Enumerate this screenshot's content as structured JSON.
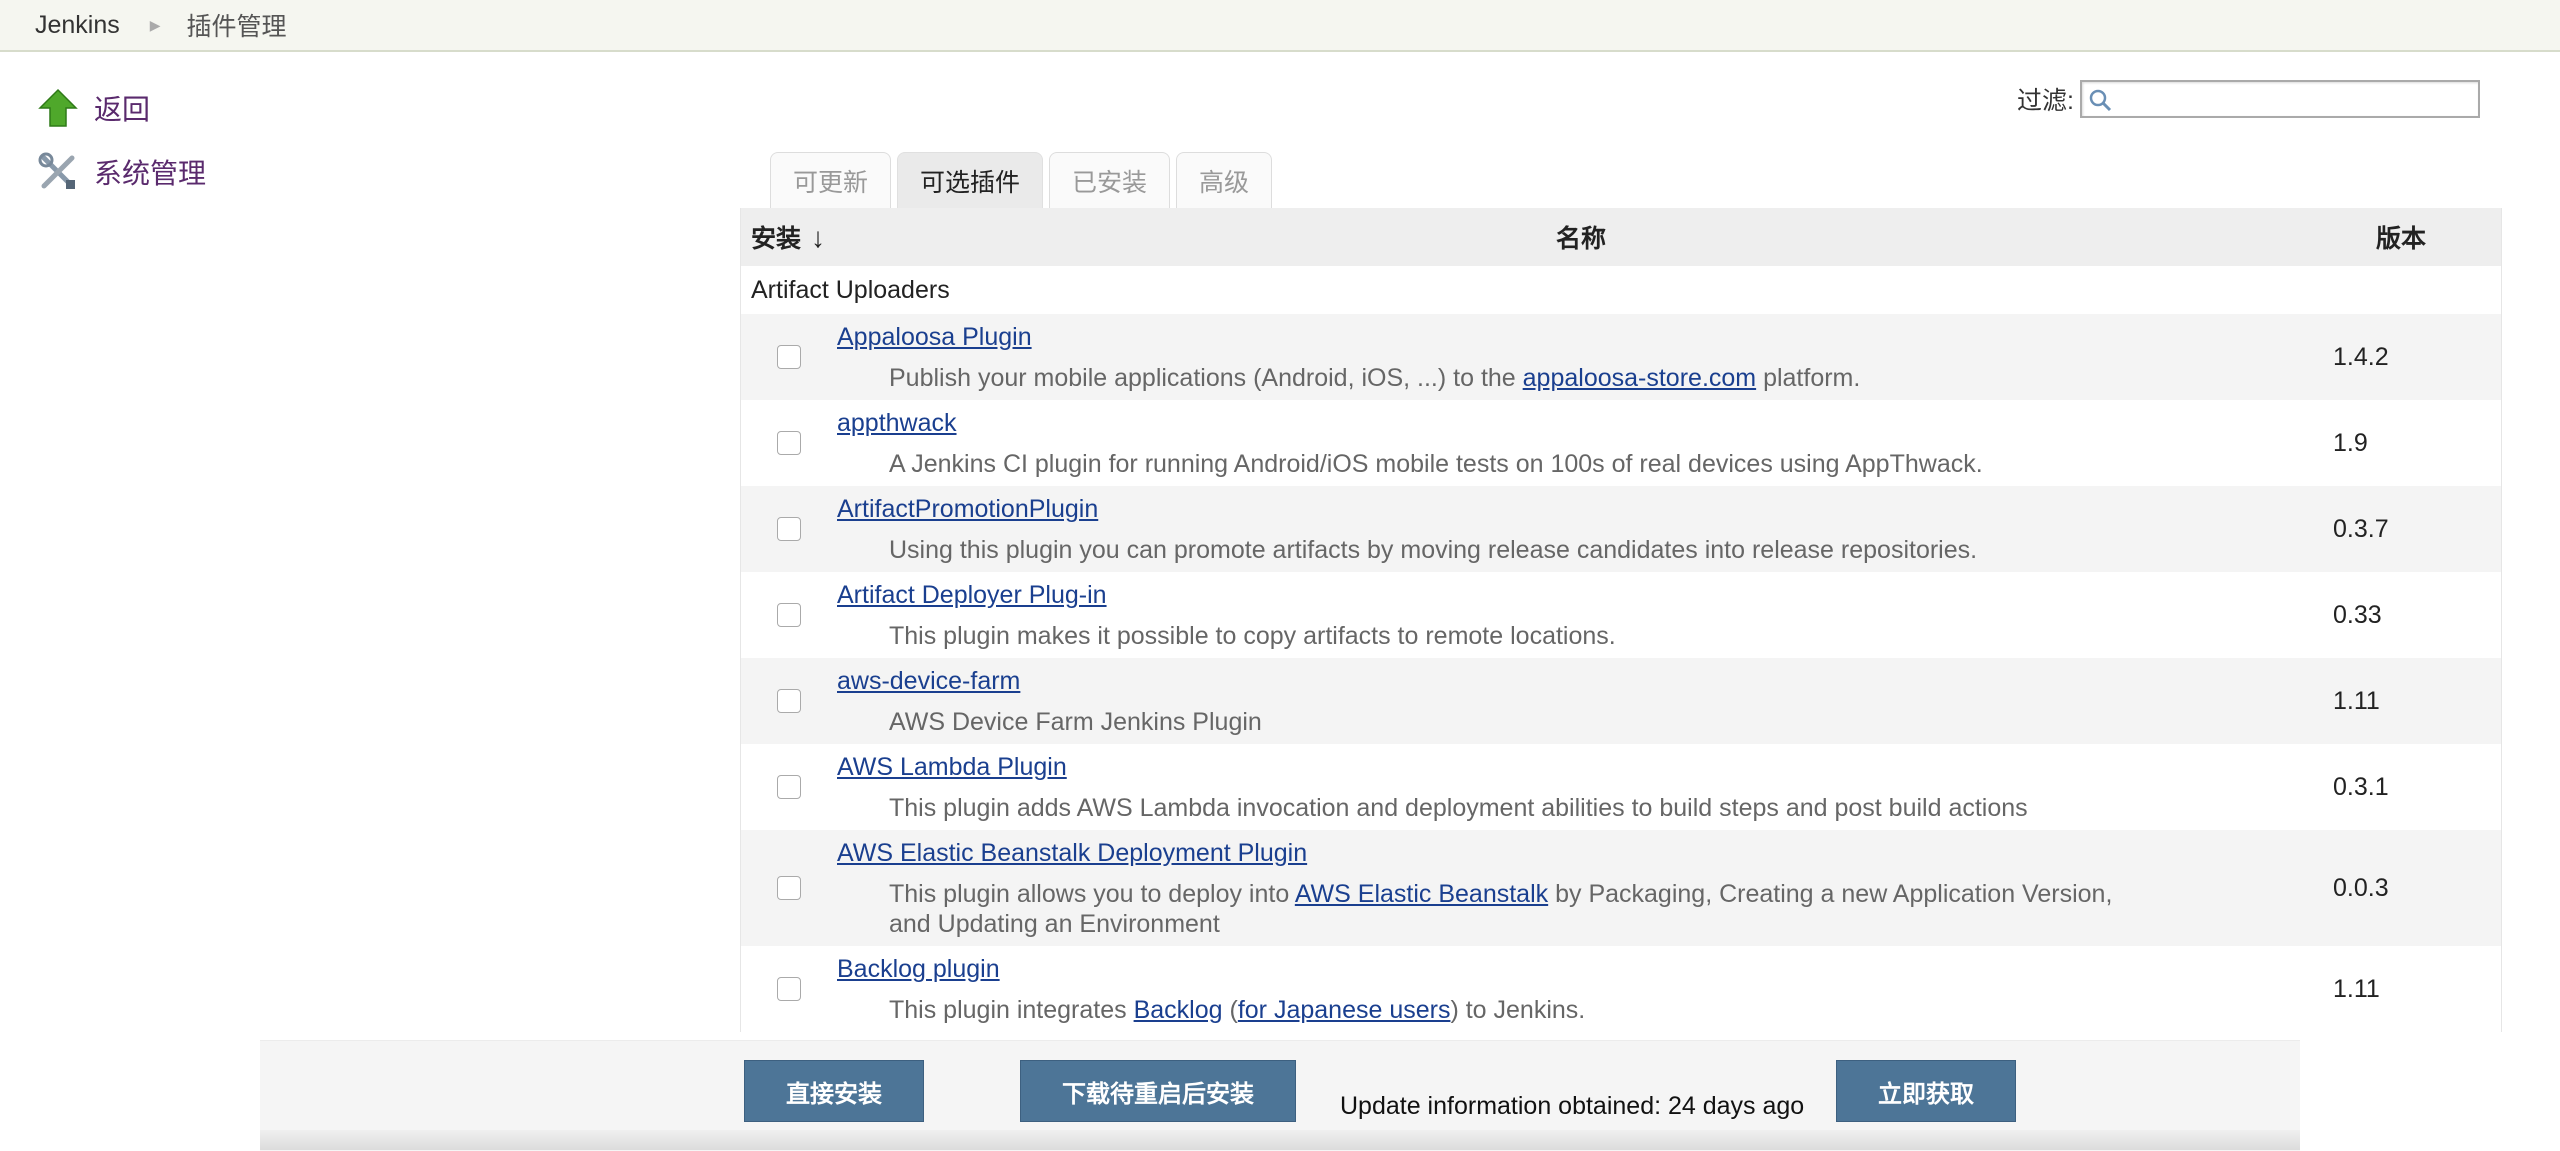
{
  "breadcrumb": {
    "root": "Jenkins",
    "current": "插件管理"
  },
  "sidebar": {
    "items": [
      {
        "label": "返回",
        "icon": "up-arrow-icon"
      },
      {
        "label": "系统管理",
        "icon": "tools-icon"
      }
    ]
  },
  "filter": {
    "label": "过滤:",
    "value": ""
  },
  "tabs": [
    {
      "label": "可更新"
    },
    {
      "label": "可选插件",
      "active": true
    },
    {
      "label": "已安装"
    },
    {
      "label": "高级"
    }
  ],
  "table": {
    "headers": {
      "install": "安装",
      "sort_arrow": "↓",
      "name": "名称",
      "version": "版本"
    },
    "category": "Artifact Uploaders",
    "rows": [
      {
        "name": "Appaloosa Plugin",
        "desc_before": "Publish your mobile applications (Android, iOS, ...) to the ",
        "desc_link": "appaloosa-store.com",
        "desc_after": " platform.",
        "version": "1.4.2"
      },
      {
        "name": "appthwack",
        "desc": "A Jenkins CI plugin for running Android/iOS mobile tests on 100s of real devices using AppThwack.",
        "version": "1.9"
      },
      {
        "name": "ArtifactPromotionPlugin",
        "desc": "Using this plugin you can promote artifacts by moving release candidates into release repositories.",
        "version": "0.3.7"
      },
      {
        "name": "Artifact Deployer Plug-in",
        "desc": "This plugin makes it possible to copy artifacts to remote locations.",
        "version": "0.33"
      },
      {
        "name": "aws-device-farm",
        "desc": "AWS Device Farm Jenkins Plugin",
        "version": "1.11"
      },
      {
        "name": "AWS Lambda Plugin",
        "desc": "This plugin adds AWS Lambda invocation and deployment abilities to build steps and post build actions",
        "version": "0.3.1"
      },
      {
        "name": "AWS Elastic Beanstalk Deployment Plugin",
        "desc_before": "This plugin allows you to deploy into ",
        "desc_link": "AWS Elastic Beanstalk",
        "desc_after": " by Packaging, Creating a new Application Version, and Updating an Environment",
        "version": "0.0.3"
      },
      {
        "name": "Backlog plugin",
        "desc_before": "This plugin integrates ",
        "desc_link": "Backlog",
        "desc_mid": " (",
        "desc_link2": "for Japanese users",
        "desc_after": ") to Jenkins.",
        "version": "1.11"
      }
    ]
  },
  "footer": {
    "install_now": "直接安装",
    "download_restart": "下载待重启后安装",
    "update_info": "Update information obtained: 24 days ago",
    "check_now": "立即获取"
  },
  "colors": {
    "link": "#1a3f8f",
    "button": "#4d7597",
    "side_link": "#5a2a6d"
  }
}
